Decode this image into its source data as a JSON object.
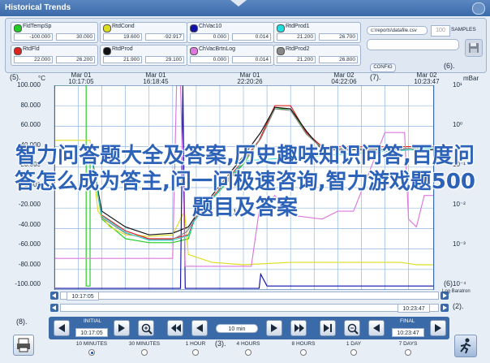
{
  "window": {
    "title": "Historical Trends"
  },
  "pens": [
    {
      "name": "FldTempSp",
      "color": "#22cc22",
      "min": "-100.000",
      "max": "30.000"
    },
    {
      "name": "RtdCond",
      "color": "#dddd22",
      "min": "19.600",
      "max": "-92.917"
    },
    {
      "name": "ChVac10",
      "color": "#1111aa",
      "min": "0.000",
      "max": "0.014"
    },
    {
      "name": "RtdProd1",
      "color": "#22dddd",
      "min": "21.200",
      "max": "26.700"
    },
    {
      "name": "RtdFld",
      "color": "#dd2222",
      "min": "22.000",
      "max": "26.200"
    },
    {
      "name": "RtdProd",
      "color": "#111111",
      "min": "21.900",
      "max": "29.100"
    },
    {
      "name": "ChVacBrtnLog",
      "color": "#dd77dd",
      "min": "0.000",
      "max": "0.014"
    },
    {
      "name": "RtdProd2",
      "color": "#888888",
      "min": "21.200",
      "max": "26.800"
    }
  ],
  "file": {
    "path": "c:\\reports\\datafile.csv",
    "samples_value": "100",
    "samples_label": "SAMPLES",
    "config_label": "CONFIG"
  },
  "axis": {
    "left_unit": "°C",
    "right_unit": "mBar",
    "left_ticks": [
      "100.000",
      "80.000",
      "60.000",
      "40.000",
      "20.000",
      "0.000",
      "-20.000",
      "-40.000",
      "-60.000",
      "-80.000",
      "-100.000"
    ],
    "right_ticks": [
      "10¹",
      "10⁰",
      "10⁻¹",
      "10⁻²",
      "10⁻³",
      "10⁻⁴"
    ],
    "right_scale": "Log Baratron",
    "time_labels": [
      {
        "date": "Mar 01",
        "time": "10:17:05"
      },
      {
        "date": "Mar 01",
        "time": "16:18:45"
      },
      {
        "date": "Mar 01",
        "time": "22:20:26"
      },
      {
        "date": "Mar 02",
        "time": "04:22:06"
      },
      {
        "date": "Mar 02",
        "time": "10:23:47"
      }
    ],
    "start_time": "10:17:05",
    "end_time": "10:23:47"
  },
  "controls": {
    "initial_label": "INITIAL",
    "initial_value": "10:17:05",
    "span_value": "10 min",
    "final_label": "FINAL",
    "final_value": "10:23:47",
    "ranges": [
      "10 MINUTES",
      "30 MINUTES",
      "1 HOUR",
      "4 HOURS",
      "8 HOURS",
      "1 DAY",
      "7 DAYS"
    ],
    "selected_range": "10 MINUTES"
  },
  "annotations": {
    "a1": "(1)",
    "a2": "(2).",
    "a3": "(3).",
    "a5": "(5).",
    "a6": "(6).",
    "a7": "(7).",
    "a8": "(8)."
  },
  "overlay_text": "智力问答题大全及答案,历史趣味知识问答,百度问答怎么成为答主,问一问极速咨询,智力游戏题500题目及答案",
  "colors": {
    "titlebar": "#3a6aa8",
    "accent": "#3a6aa8",
    "plot_bg": "#ffffff",
    "grid": "#8fb5e0"
  }
}
